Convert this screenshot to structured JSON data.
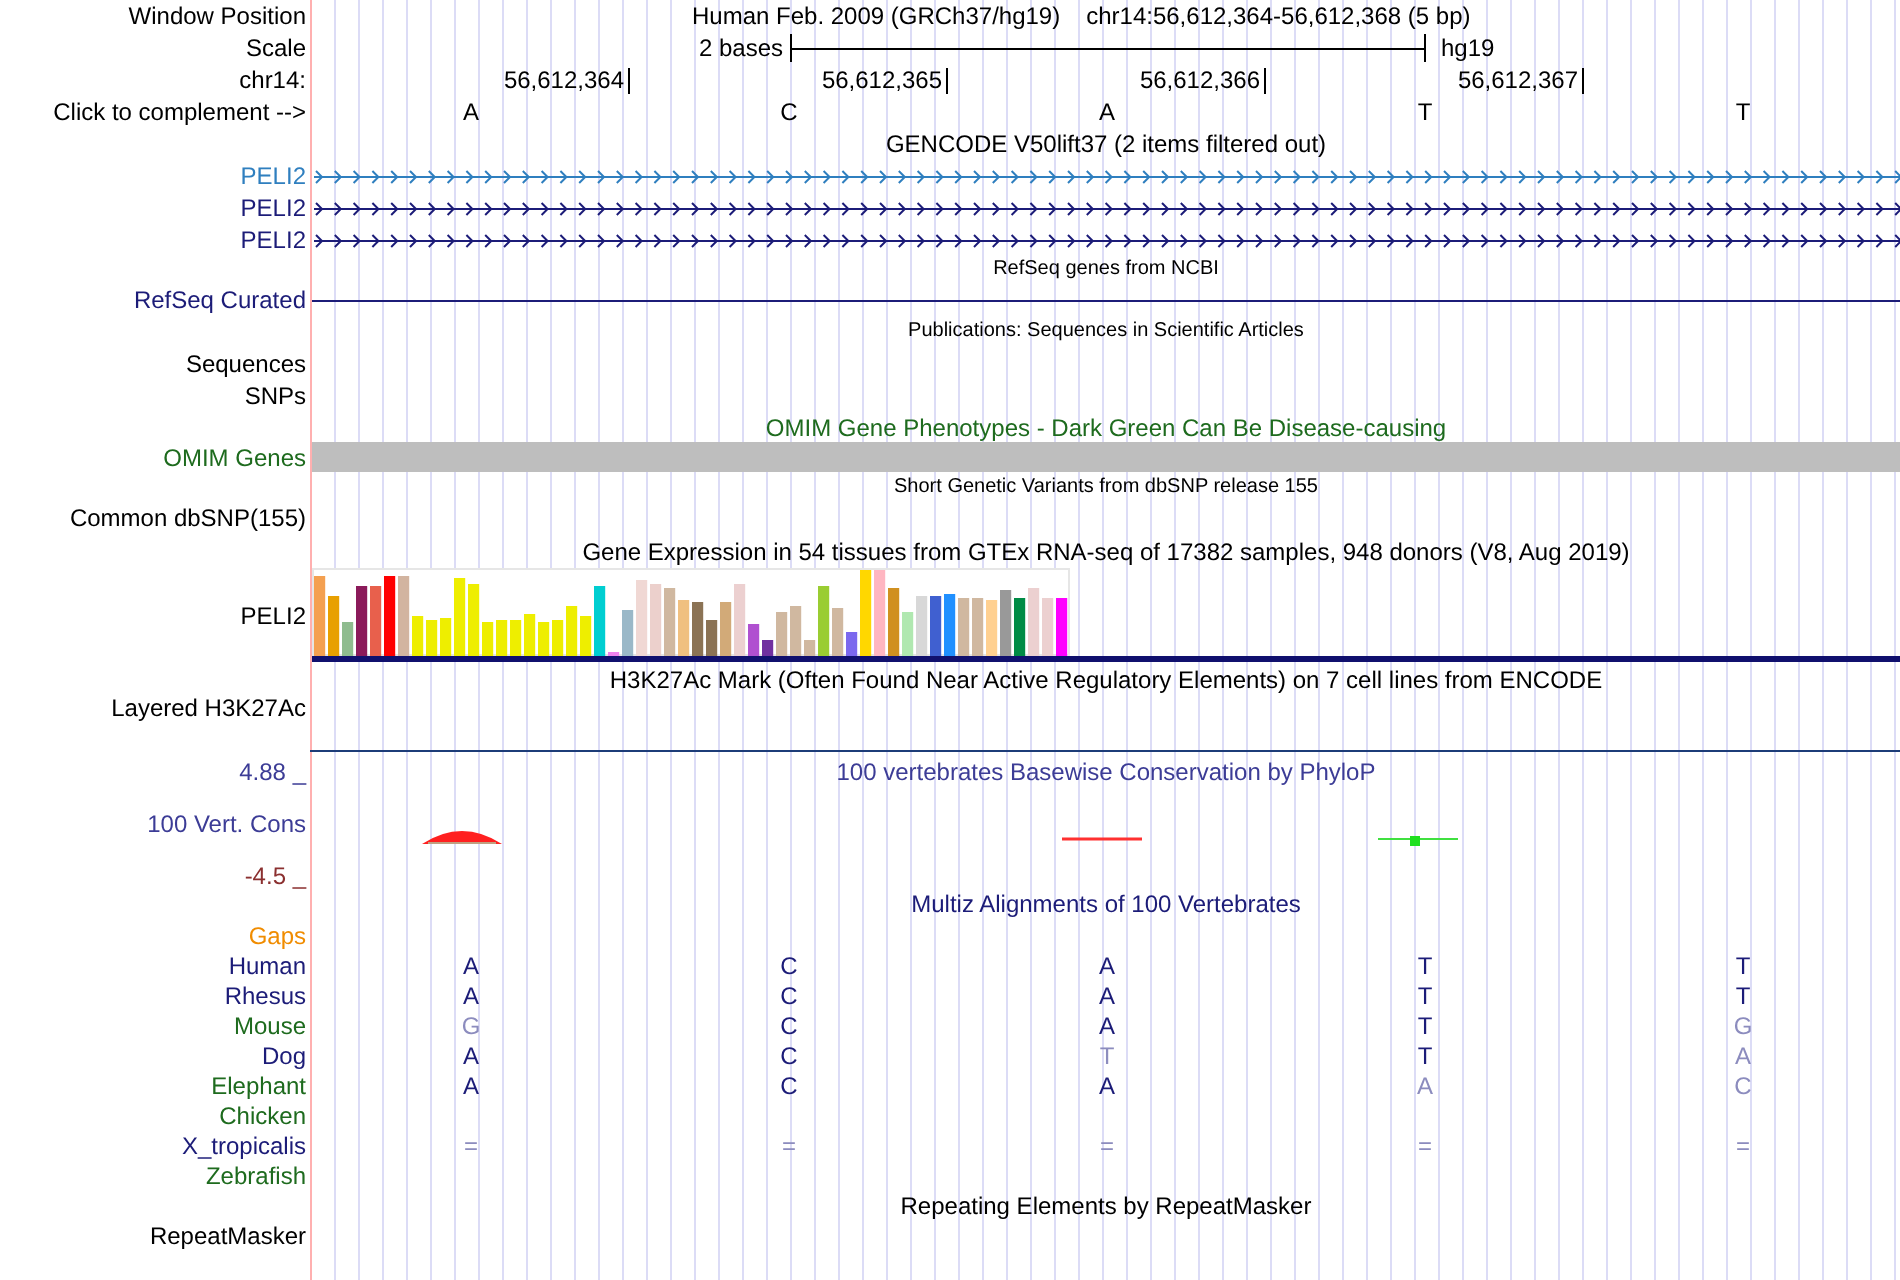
{
  "header": {
    "label": "Window Position",
    "assembly": "Human Feb. 2009 (GRCh37/hg19)",
    "position": "chr14:56,612,364-56,612,368 (5 bp)"
  },
  "scale": {
    "label": "Scale",
    "span": "2 bases",
    "assembly": "hg19"
  },
  "ruler": {
    "label": "chr14:",
    "ticks": [
      "56,612,364",
      "56,612,365",
      "56,612,366",
      "56,612,367"
    ]
  },
  "bases": {
    "label": "Click to complement -->",
    "letters": [
      "A",
      "C",
      "A",
      "T",
      "T"
    ]
  },
  "tracks": [
    {
      "kind": "gene-stack",
      "title": "GENCODE V50lift37 (2 items filtered out)",
      "items": [
        {
          "label": "PELI2",
          "color": "#2f7fbf"
        },
        {
          "label": "PELI2",
          "color": "#1c1c78"
        },
        {
          "label": "PELI2",
          "color": "#1c1c78"
        }
      ]
    },
    {
      "kind": "gene-line",
      "title": "RefSeq genes from NCBI",
      "label": "RefSeq Curated",
      "color": "#1c1c78"
    },
    {
      "kind": "publications",
      "title": "Publications: Sequences in Scientific Articles",
      "labels": [
        "Sequences",
        "SNPs"
      ]
    },
    {
      "kind": "bar",
      "title": "OMIM Gene Phenotypes - Dark Green Can Be Disease-causing",
      "label": "OMIM Genes",
      "color": "#1e6b1e"
    },
    {
      "kind": "variants",
      "title": "Short Genetic Variants from dbSNP release 155",
      "labels": [
        "Common dbSNP(155)"
      ]
    },
    {
      "kind": "expression",
      "title": "Gene Expression in 54 tissues from GTEx RNA-seq of 17382 samples, 948 donors (V8, Aug 2019)",
      "label": "PELI2"
    },
    {
      "kind": "signal",
      "title": "H3K27Ac Mark (Often Found Near Active Regulatory Elements) on 7 cell lines from ENCODE",
      "label": "Layered H3K27Ac"
    },
    {
      "kind": "wiggle",
      "title": "100 vertebrates Basewise Conservation by PhyloP",
      "label": "100 Vert. Cons",
      "axis_labels": [
        {
          "text": "4.88 _",
          "color": "#3c3c96"
        },
        {
          "text": "-4.5 _",
          "color": "#8b3030"
        }
      ],
      "color": "#3c3c96"
    },
    {
      "kind": "alignment",
      "title": "Multiz Alignments of 100 Vertebrates",
      "color": "#1c1c78",
      "species": [
        {
          "label": "Gaps",
          "color": "#f08c00"
        },
        {
          "label": "Human",
          "color": "#1c1c78",
          "bases": [
            {
              "text": "A",
              "faded": false
            },
            {
              "text": "C",
              "faded": false
            },
            {
              "text": "A",
              "faded": false
            },
            {
              "text": "T",
              "faded": false
            },
            {
              "text": "T",
              "faded": false
            }
          ]
        },
        {
          "label": "Rhesus",
          "color": "#1c1c78",
          "bases": [
            {
              "text": "A",
              "faded": false
            },
            {
              "text": "C",
              "faded": false
            },
            {
              "text": "A",
              "faded": false
            },
            {
              "text": "T",
              "faded": false
            },
            {
              "text": "T",
              "faded": false
            }
          ]
        },
        {
          "label": "Mouse",
          "color": "#1e6b1e",
          "bases": [
            {
              "text": "G",
              "faded": true
            },
            {
              "text": "C",
              "faded": false
            },
            {
              "text": "A",
              "faded": false
            },
            {
              "text": "T",
              "faded": false
            },
            {
              "text": "G",
              "faded": true
            }
          ]
        },
        {
          "label": "Dog",
          "color": "#1c1c78",
          "bases": [
            {
              "text": "A",
              "faded": false
            },
            {
              "text": "C",
              "faded": false
            },
            {
              "text": "T",
              "faded": true
            },
            {
              "text": "T",
              "faded": false
            },
            {
              "text": "A",
              "faded": true
            }
          ]
        },
        {
          "label": "Elephant",
          "color": "#1e6b1e",
          "bases": [
            {
              "text": "A",
              "faded": false
            },
            {
              "text": "C",
              "faded": false
            },
            {
              "text": "A",
              "faded": false
            },
            {
              "text": "A",
              "faded": true
            },
            {
              "text": "C",
              "faded": true
            }
          ]
        },
        {
          "label": "Chicken",
          "color": "#1e6b1e"
        },
        {
          "label": "X_tropicalis",
          "color": "#1c1c78",
          "bases": [
            {
              "text": "=",
              "faded": true
            },
            {
              "text": "=",
              "faded": true
            },
            {
              "text": "=",
              "faded": true
            },
            {
              "text": "=",
              "faded": true
            },
            {
              "text": "=",
              "faded": true
            }
          ]
        },
        {
          "label": "Zebrafish",
          "color": "#1e6b1e"
        }
      ]
    },
    {
      "kind": "repeats",
      "title": "Repeating Elements by RepeatMasker",
      "labels": [
        "RepeatMasker"
      ]
    }
  ]
}
